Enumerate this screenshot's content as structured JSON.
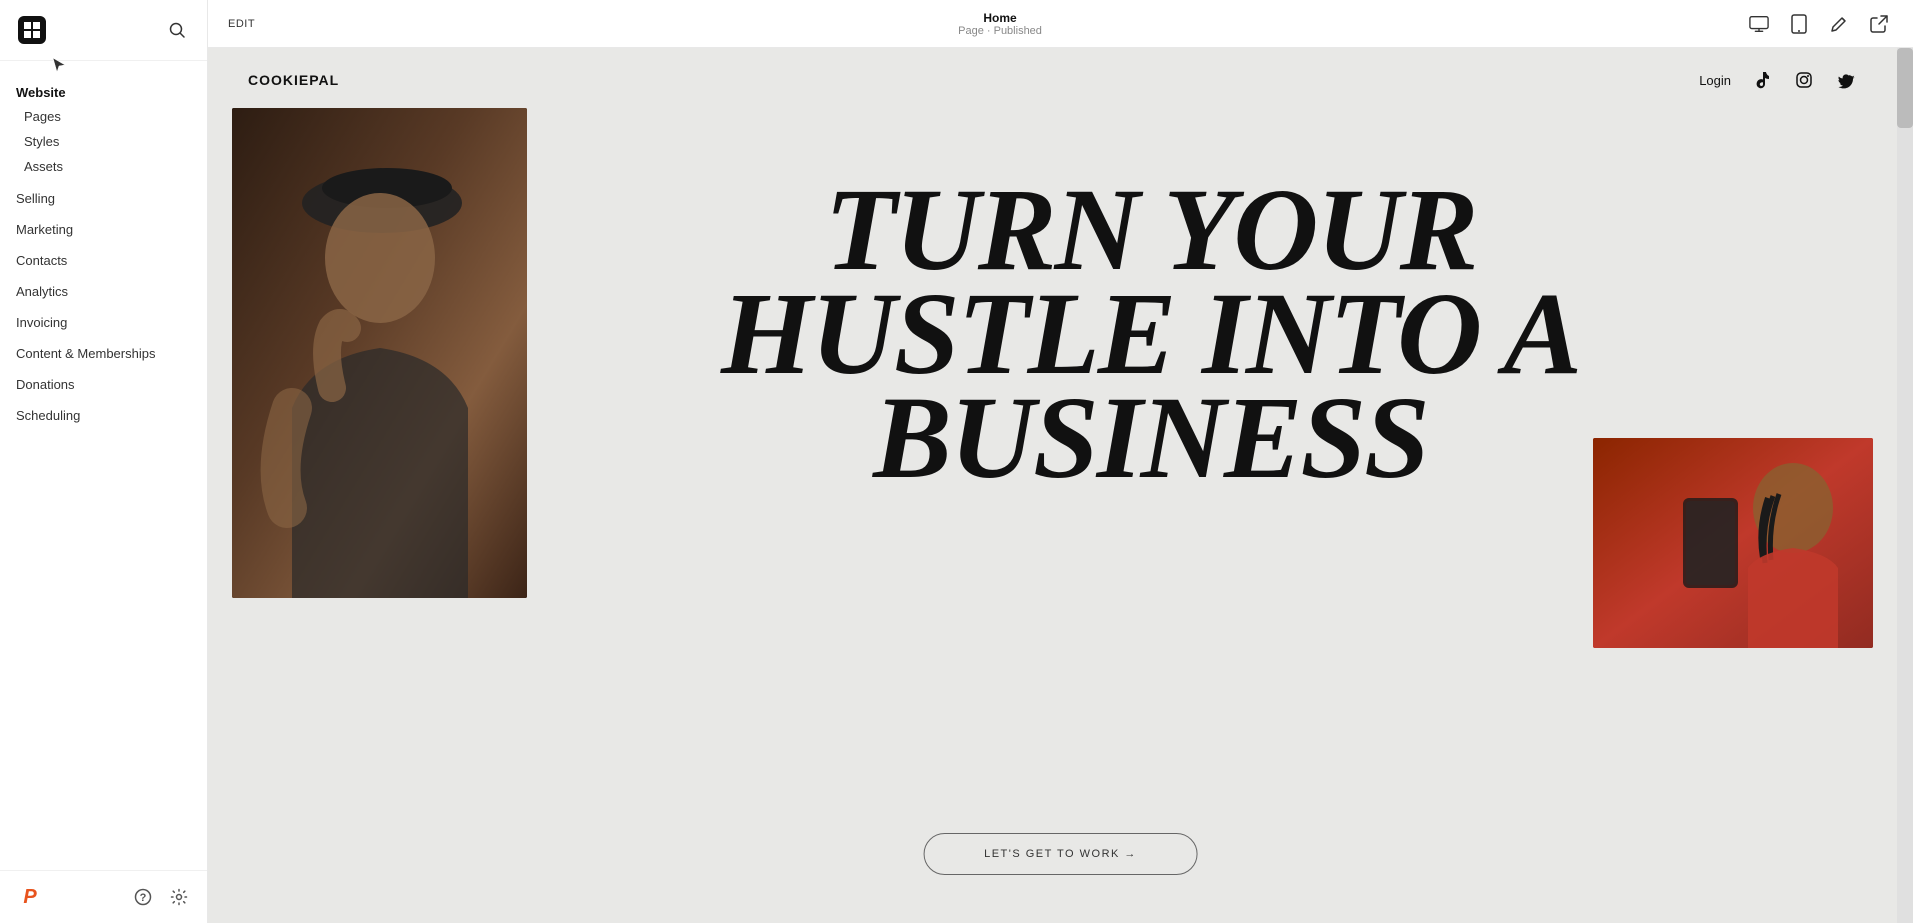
{
  "sidebar": {
    "logo_alt": "Squarespace logo",
    "search_label": "Search",
    "section_website": "Website",
    "items_website": [
      {
        "label": "Pages",
        "id": "pages"
      },
      {
        "label": "Styles",
        "id": "styles"
      },
      {
        "label": "Assets",
        "id": "assets"
      }
    ],
    "nav_items": [
      {
        "label": "Selling",
        "id": "selling"
      },
      {
        "label": "Marketing",
        "id": "marketing"
      },
      {
        "label": "Contacts",
        "id": "contacts"
      },
      {
        "label": "Analytics",
        "id": "analytics"
      },
      {
        "label": "Invoicing",
        "id": "invoicing"
      },
      {
        "label": "Content & Memberships",
        "id": "content-memberships"
      },
      {
        "label": "Donations",
        "id": "donations"
      },
      {
        "label": "Scheduling",
        "id": "scheduling"
      }
    ],
    "bottom_p_logo": "P",
    "help_label": "Help",
    "settings_label": "Settings"
  },
  "topbar": {
    "edit_label": "EDIT",
    "page_title": "Home",
    "page_status": "Page · Published",
    "desktop_label": "Desktop view",
    "tablet_label": "Tablet view",
    "edit_mode_label": "Edit mode",
    "external_label": "Open in new tab"
  },
  "preview": {
    "site_logo": "COOKIEPAL",
    "nav_login": "Login",
    "social_tiktok": "TikTok",
    "social_instagram": "Instagram",
    "social_twitter": "Twitter",
    "headline_line1": "TURN YOUR",
    "headline_line2": "HUSTLE INTO A",
    "headline_line3": "BUSINESS",
    "cta_button": "LET'S GET TO WORK →"
  },
  "colors": {
    "sidebar_bg": "#ffffff",
    "topbar_bg": "#ffffff",
    "preview_bg": "#e8e8e6",
    "headline_color": "#111111",
    "accent_orange": "#e8541e"
  }
}
